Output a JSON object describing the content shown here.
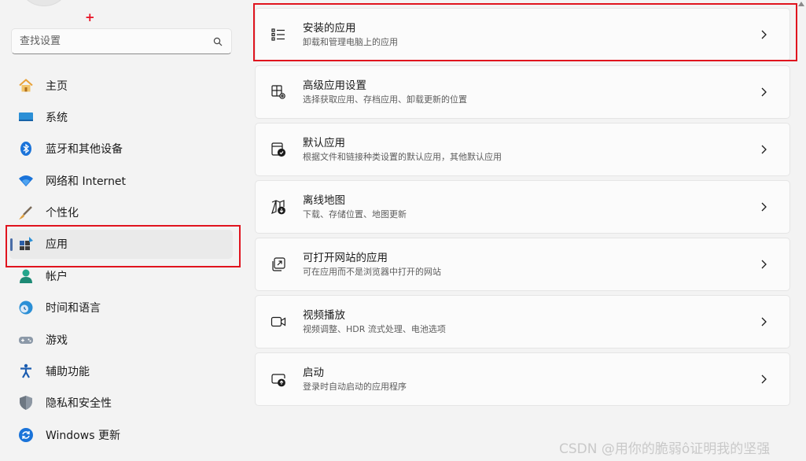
{
  "sidebar": {
    "plus_mark": "+",
    "search": {
      "placeholder": "查找设置",
      "value": ""
    },
    "items": [
      {
        "label": "主页",
        "icon": "home-icon"
      },
      {
        "label": "系统",
        "icon": "system-icon"
      },
      {
        "label": "蓝牙和其他设备",
        "icon": "bluetooth-icon"
      },
      {
        "label": "网络和 Internet",
        "icon": "wifi-icon"
      },
      {
        "label": "个性化",
        "icon": "brush-icon"
      },
      {
        "label": "应用",
        "icon": "apps-icon",
        "active": true
      },
      {
        "label": "帐户",
        "icon": "account-icon"
      },
      {
        "label": "时间和语言",
        "icon": "time-language-icon"
      },
      {
        "label": "游戏",
        "icon": "gamepad-icon"
      },
      {
        "label": "辅助功能",
        "icon": "accessibility-icon"
      },
      {
        "label": "隐私和安全性",
        "icon": "shield-icon"
      },
      {
        "label": "Windows 更新",
        "icon": "update-icon"
      }
    ]
  },
  "main": {
    "cards": [
      {
        "title": "安装的应用",
        "subtitle": "卸载和管理电脑上的应用",
        "icon": "list-icon"
      },
      {
        "title": "高级应用设置",
        "subtitle": "选择获取应用、存档应用、卸载更新的位置",
        "icon": "advanced-settings-icon"
      },
      {
        "title": "默认应用",
        "subtitle": "根据文件和链接种类设置的默认应用，其他默认应用",
        "icon": "default-apps-icon"
      },
      {
        "title": "离线地图",
        "subtitle": "下载、存储位置、地图更新",
        "icon": "offline-map-icon"
      },
      {
        "title": "可打开网站的应用",
        "subtitle": "可在应用而不是浏览器中打开的网站",
        "icon": "open-in-app-icon"
      },
      {
        "title": "视频播放",
        "subtitle": "视频调整、HDR 流式处理、电池选项",
        "icon": "video-icon"
      },
      {
        "title": "启动",
        "subtitle": "登录时自动启动的应用程序",
        "icon": "startup-icon"
      }
    ]
  },
  "watermark": "CSDN @用你的脆弱ô证明我的坚强",
  "colors": {
    "highlight": "#e0141e",
    "accent": "#0067c0",
    "active_indicator": "#4a6da7"
  }
}
